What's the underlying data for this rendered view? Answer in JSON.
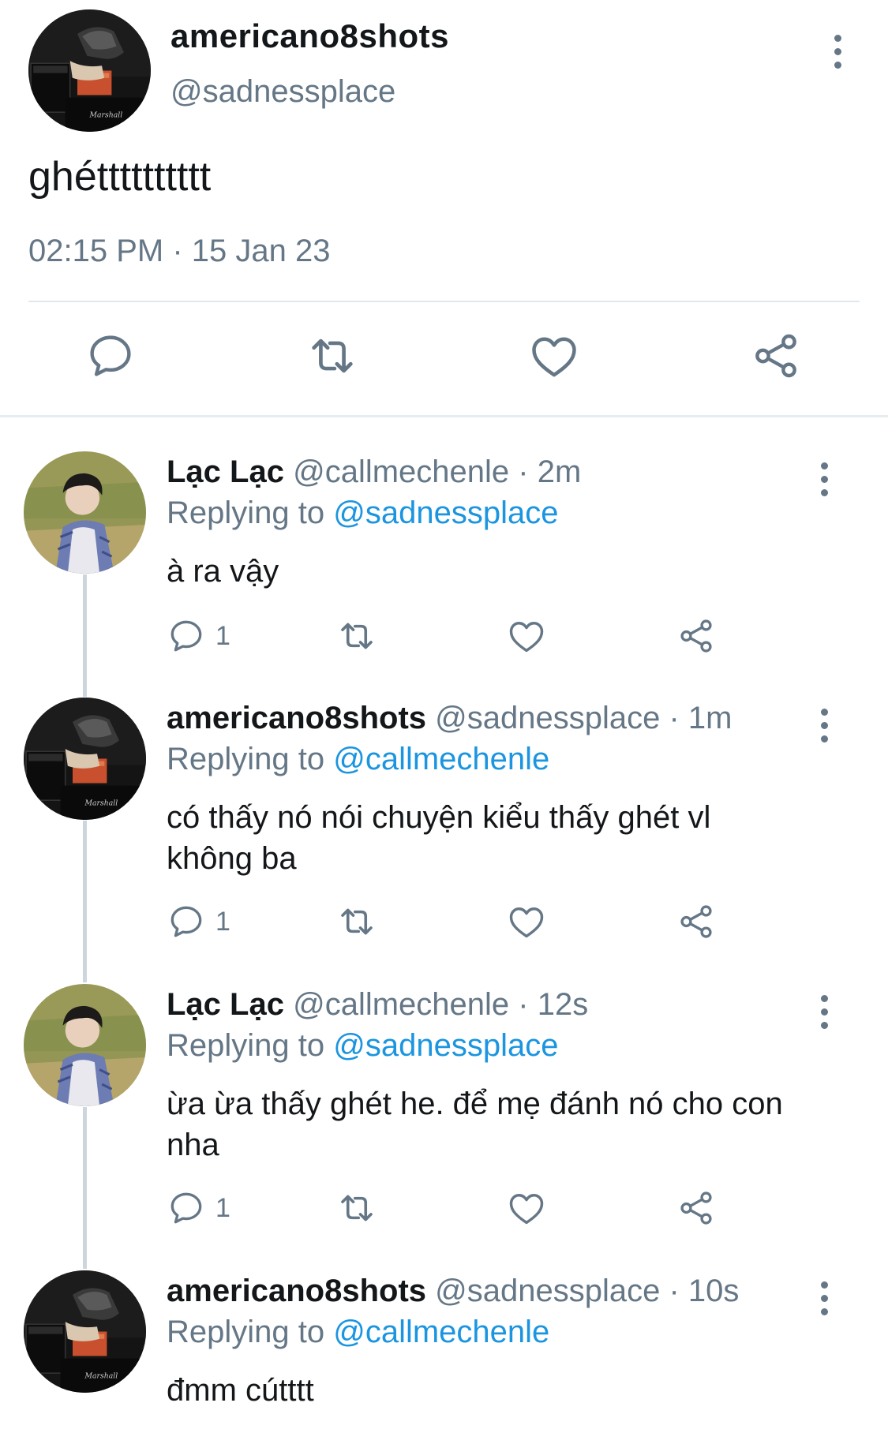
{
  "tweet": {
    "author_name": "americano8shots",
    "author_handle": "@sadnessplace",
    "text": "ghétttttttttt",
    "timestamp": "02:15 PM · 15 Jan 23",
    "actions": [
      "reply-icon",
      "retweet-icon",
      "like-icon",
      "share-icon"
    ]
  },
  "replies": [
    {
      "name": "Lạc Lạc",
      "handle_time": "@callmechenle · 2m",
      "replying_label": "Replying to ",
      "replying_to": "@sadnessplace",
      "text": "à ra vậy",
      "reply_count": "1",
      "avatar": "boy-avatar"
    },
    {
      "name": "americano8shots",
      "handle_time": "@sadnessplace · 1m",
      "replying_label": "Replying to ",
      "replying_to": "@callmechenle",
      "text": "có thấy nó nói chuyện kiểu thấy ghét vl không ba",
      "reply_count": "1",
      "avatar": "amp-avatar"
    },
    {
      "name": "Lạc Lạc",
      "handle_time": "@callmechenle · 12s",
      "replying_label": "Replying to ",
      "replying_to": "@sadnessplace",
      "text": "ừa ừa thấy ghét he. để mẹ đánh nó cho con nha",
      "reply_count": "1",
      "avatar": "boy-avatar"
    },
    {
      "name": "americano8shots",
      "handle_time": "@sadnessplace · 10s",
      "replying_label": "Replying to ",
      "replying_to": "@callmechenle",
      "text": "đmm cútttt",
      "avatar": "amp-avatar"
    }
  ],
  "colors": {
    "text": "#14171a",
    "secondary": "#657786",
    "link": "#1b95e0",
    "divider": "#e1e8ed"
  }
}
